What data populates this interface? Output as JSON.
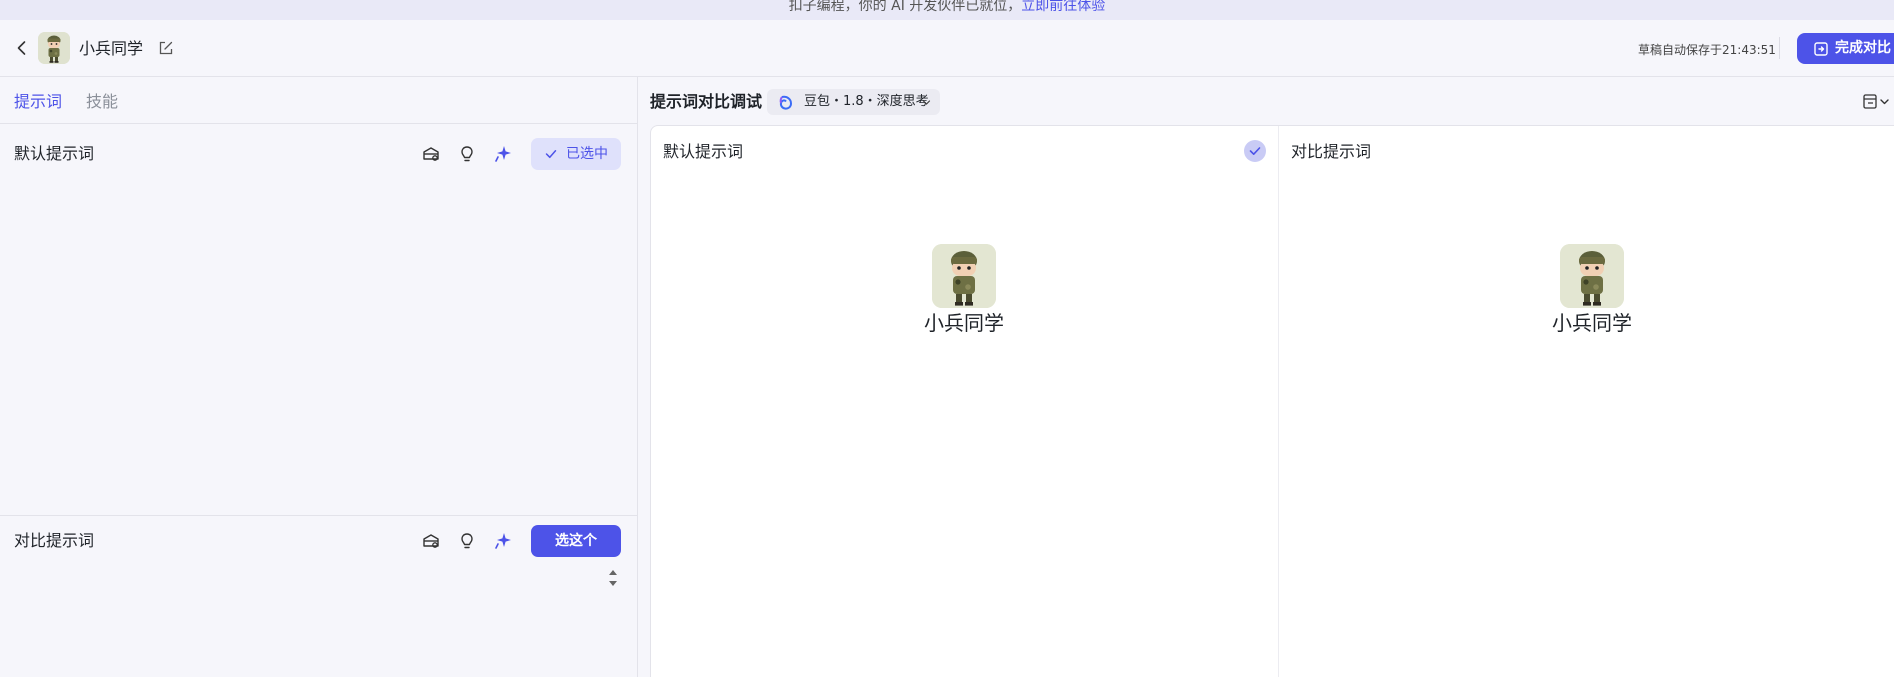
{
  "banner": {
    "text": "扣子编程，你的 AI 开发伙伴已就位，",
    "link": "立即前往体验"
  },
  "header": {
    "bot_name": "小兵同学",
    "save_status": "草稿自动保存于21:43:51",
    "done_label": "完成对比"
  },
  "left_panel": {
    "tabs": [
      {
        "label": "提示词",
        "active": true
      },
      {
        "label": "技能",
        "active": false
      }
    ],
    "default_prompt": {
      "title": "默认提示词",
      "selected_label": "已选中"
    },
    "compare_prompt": {
      "title": "对比提示词",
      "choose_label": "选这个"
    }
  },
  "right_panel": {
    "title": "提示词对比调试",
    "model": "豆包・1.8・深度思考",
    "columns": [
      {
        "title": "默认提示词",
        "bot_name": "小兵同学",
        "checked": true
      },
      {
        "title": "对比提示词",
        "bot_name": "小兵同学",
        "checked": false
      }
    ]
  },
  "colors": {
    "accent": "#4d53e8",
    "accent_light": "#dfe1fb",
    "background": "#f6f6fb",
    "banner_bg": "#e9e9f7"
  },
  "icons": {
    "back": "chevron-left-icon",
    "edit": "edit-icon",
    "done": "exit-icon",
    "prompt_tools": [
      "template-library-icon",
      "idea-bulb-icon",
      "auto-optimize-sparkle-icon"
    ],
    "selected": "check-icon",
    "layout": "layout-settings-icon"
  }
}
